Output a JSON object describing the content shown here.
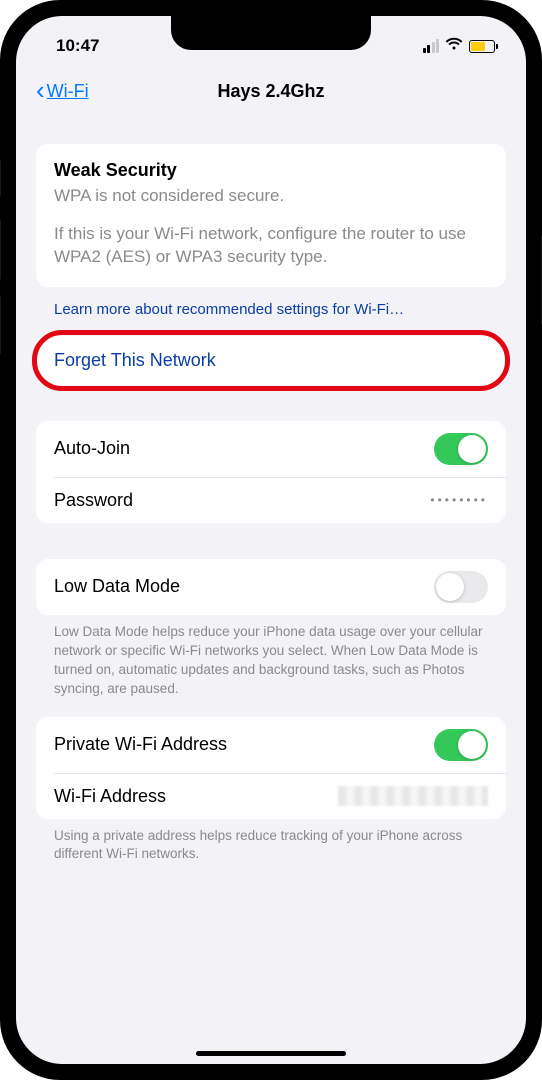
{
  "status": {
    "time": "10:47"
  },
  "nav": {
    "back_label": "Wi-Fi",
    "title": "Hays 2.4Ghz"
  },
  "security": {
    "title": "Weak Security",
    "subtitle": "WPA is not considered secure.",
    "description": "If this is your Wi-Fi network, configure the router to use WPA2 (AES) or WPA3 security type.",
    "learn_more": "Learn more about recommended settings for Wi-Fi…"
  },
  "forget": {
    "label": "Forget This Network"
  },
  "settings": {
    "auto_join": {
      "label": "Auto-Join",
      "on": true
    },
    "password": {
      "label": "Password",
      "value": "••••••••"
    },
    "low_data": {
      "label": "Low Data Mode",
      "on": false
    },
    "low_data_footer": "Low Data Mode helps reduce your iPhone data usage over your cellular network or specific Wi-Fi networks you select. When Low Data Mode is turned on, automatic updates and background tasks, such as Photos syncing, are paused.",
    "private_wifi": {
      "label": "Private Wi-Fi Address",
      "on": true
    },
    "wifi_address": {
      "label": "Wi-Fi Address"
    },
    "private_footer": "Using a private address helps reduce tracking of your iPhone across different Wi-Fi networks."
  }
}
